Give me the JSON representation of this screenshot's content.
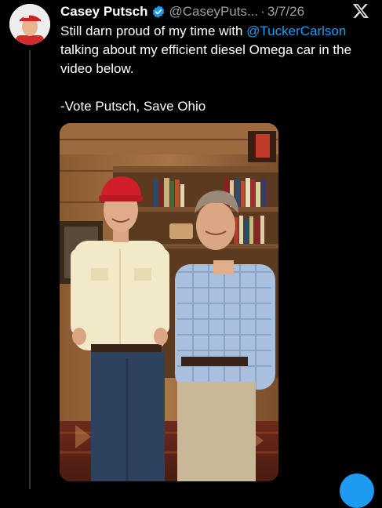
{
  "tweet": {
    "display_name": "Casey Putsch",
    "handle": "@CaseyPuts...",
    "separator": "·",
    "date": "3/7/26",
    "text_before": "Still darn proud of my time with ",
    "mention": "@TuckerCarlson",
    "text_after": " talking about my efficient diesel Omega car in the video below.",
    "signoff": "-Vote Putsch, Save Ohio"
  },
  "icons": {
    "verified": "verified-badge-icon",
    "logo": "x-logo-icon"
  },
  "colors": {
    "background": "#000000",
    "text": "#ffffff",
    "secondary_text": "#9a9fa4",
    "link": "#1d9bf0",
    "verified": "#1d9bf0"
  }
}
